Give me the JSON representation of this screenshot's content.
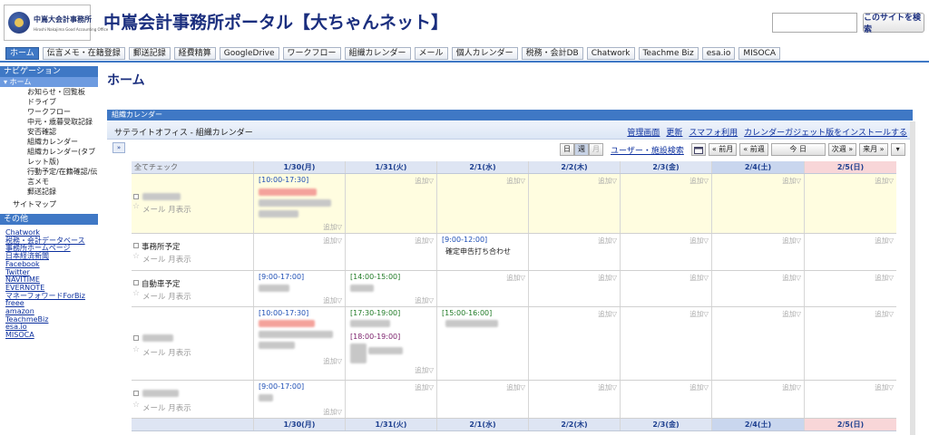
{
  "header": {
    "logo_line1": "中嶌大会計事務所",
    "logo_line2": "Hiroshi Nakajima Good Accounting Office",
    "site_title": "中嶌会計事務所ポータル【大ちゃんネット】",
    "search_placeholder": "",
    "search_button": "このサイトを検索"
  },
  "tabs": [
    "ホーム",
    "伝言メモ・在籍登録",
    "郵送記録",
    "経費精算",
    "GoogleDrive",
    "ワークフロー",
    "組織カレンダー",
    "メール",
    "個人カレンダー",
    "税務・会計DB",
    "Chatwork",
    "Teachme Biz",
    "esa.io",
    "MISOCA"
  ],
  "sidebar": {
    "nav_title": "ナビゲーション",
    "home": "ホーム",
    "items": [
      "お知らせ・回覧板",
      "ドライブ",
      "ワークフロー",
      "中元・歳暮受取記録",
      "安否確認",
      "組織カレンダー",
      "組織カレンダー(タブレット版)",
      "行動予定/在籍確認/伝言メモ",
      "郵送記録"
    ],
    "sitemap": "サイトマップ",
    "other_title": "その他",
    "links": [
      "Chatwork",
      "税務・会計データベース",
      "事務所ホームページ",
      "日本経済新聞",
      "Facebook",
      "Twitter",
      "NAVITIME",
      "EVERNOTE",
      "マネーフォワードForBiz",
      "freee",
      "amazon",
      "TeachmeBiz",
      "esa.io",
      "MISOCA"
    ]
  },
  "main": {
    "page_title": "ホーム",
    "gadget_title": "組織カレンダー",
    "calendar_title": "サテライトオフィス - 組織カレンダー",
    "top_links": [
      "管理画面",
      "更新",
      "スマフォ利用",
      "カレンダーガジェット版をインストールする"
    ],
    "expand": "»",
    "toolbar": {
      "day": "日",
      "week": "週",
      "month": "月",
      "resource_search": "ユーザー・施設検索",
      "prev_month": "« 前月",
      "prev_week": "« 前週",
      "today": "今 日",
      "next_week": "次週 »",
      "next_month": "来月 »",
      "menu": "▾"
    }
  },
  "calendar": {
    "all_check": "全てチェック",
    "days": [
      "1/30(月)",
      "1/31(火)",
      "2/1(水)",
      "2/2(木)",
      "2/3(金)",
      "2/4(土)",
      "2/5(日)"
    ],
    "add_label": "追加▽",
    "row_meta": "メール 月表示",
    "rows": [
      {
        "name": "",
        "events": [
          {
            "day": 0,
            "time": "[10:00-17:30]",
            "color": "blue"
          }
        ]
      },
      {
        "name": "事務所予定",
        "events": [
          {
            "day": 2,
            "time": "[9:00-12:00]",
            "color": "blue",
            "text": "確定申告打ち合わせ"
          }
        ]
      },
      {
        "name": "自動車予定",
        "events": [
          {
            "day": 0,
            "time": "[9:00-17:00]",
            "color": "blue"
          },
          {
            "day": 1,
            "time": "[14:00-15:00]",
            "color": "green"
          }
        ]
      },
      {
        "name": "",
        "events": [
          {
            "day": 0,
            "time": "[10:00-17:30]",
            "color": "blue"
          },
          {
            "day": 1,
            "time": "[17:30-19:00]",
            "color": "green"
          },
          {
            "day": 1,
            "time": "[18:00-19:00]",
            "color": "purple"
          },
          {
            "day": 2,
            "time": "[15:00-16:00]",
            "color": "green"
          }
        ]
      },
      {
        "name": "",
        "events": [
          {
            "day": 0,
            "time": "[9:00-17:00]",
            "color": "blue"
          }
        ]
      }
    ]
  }
}
